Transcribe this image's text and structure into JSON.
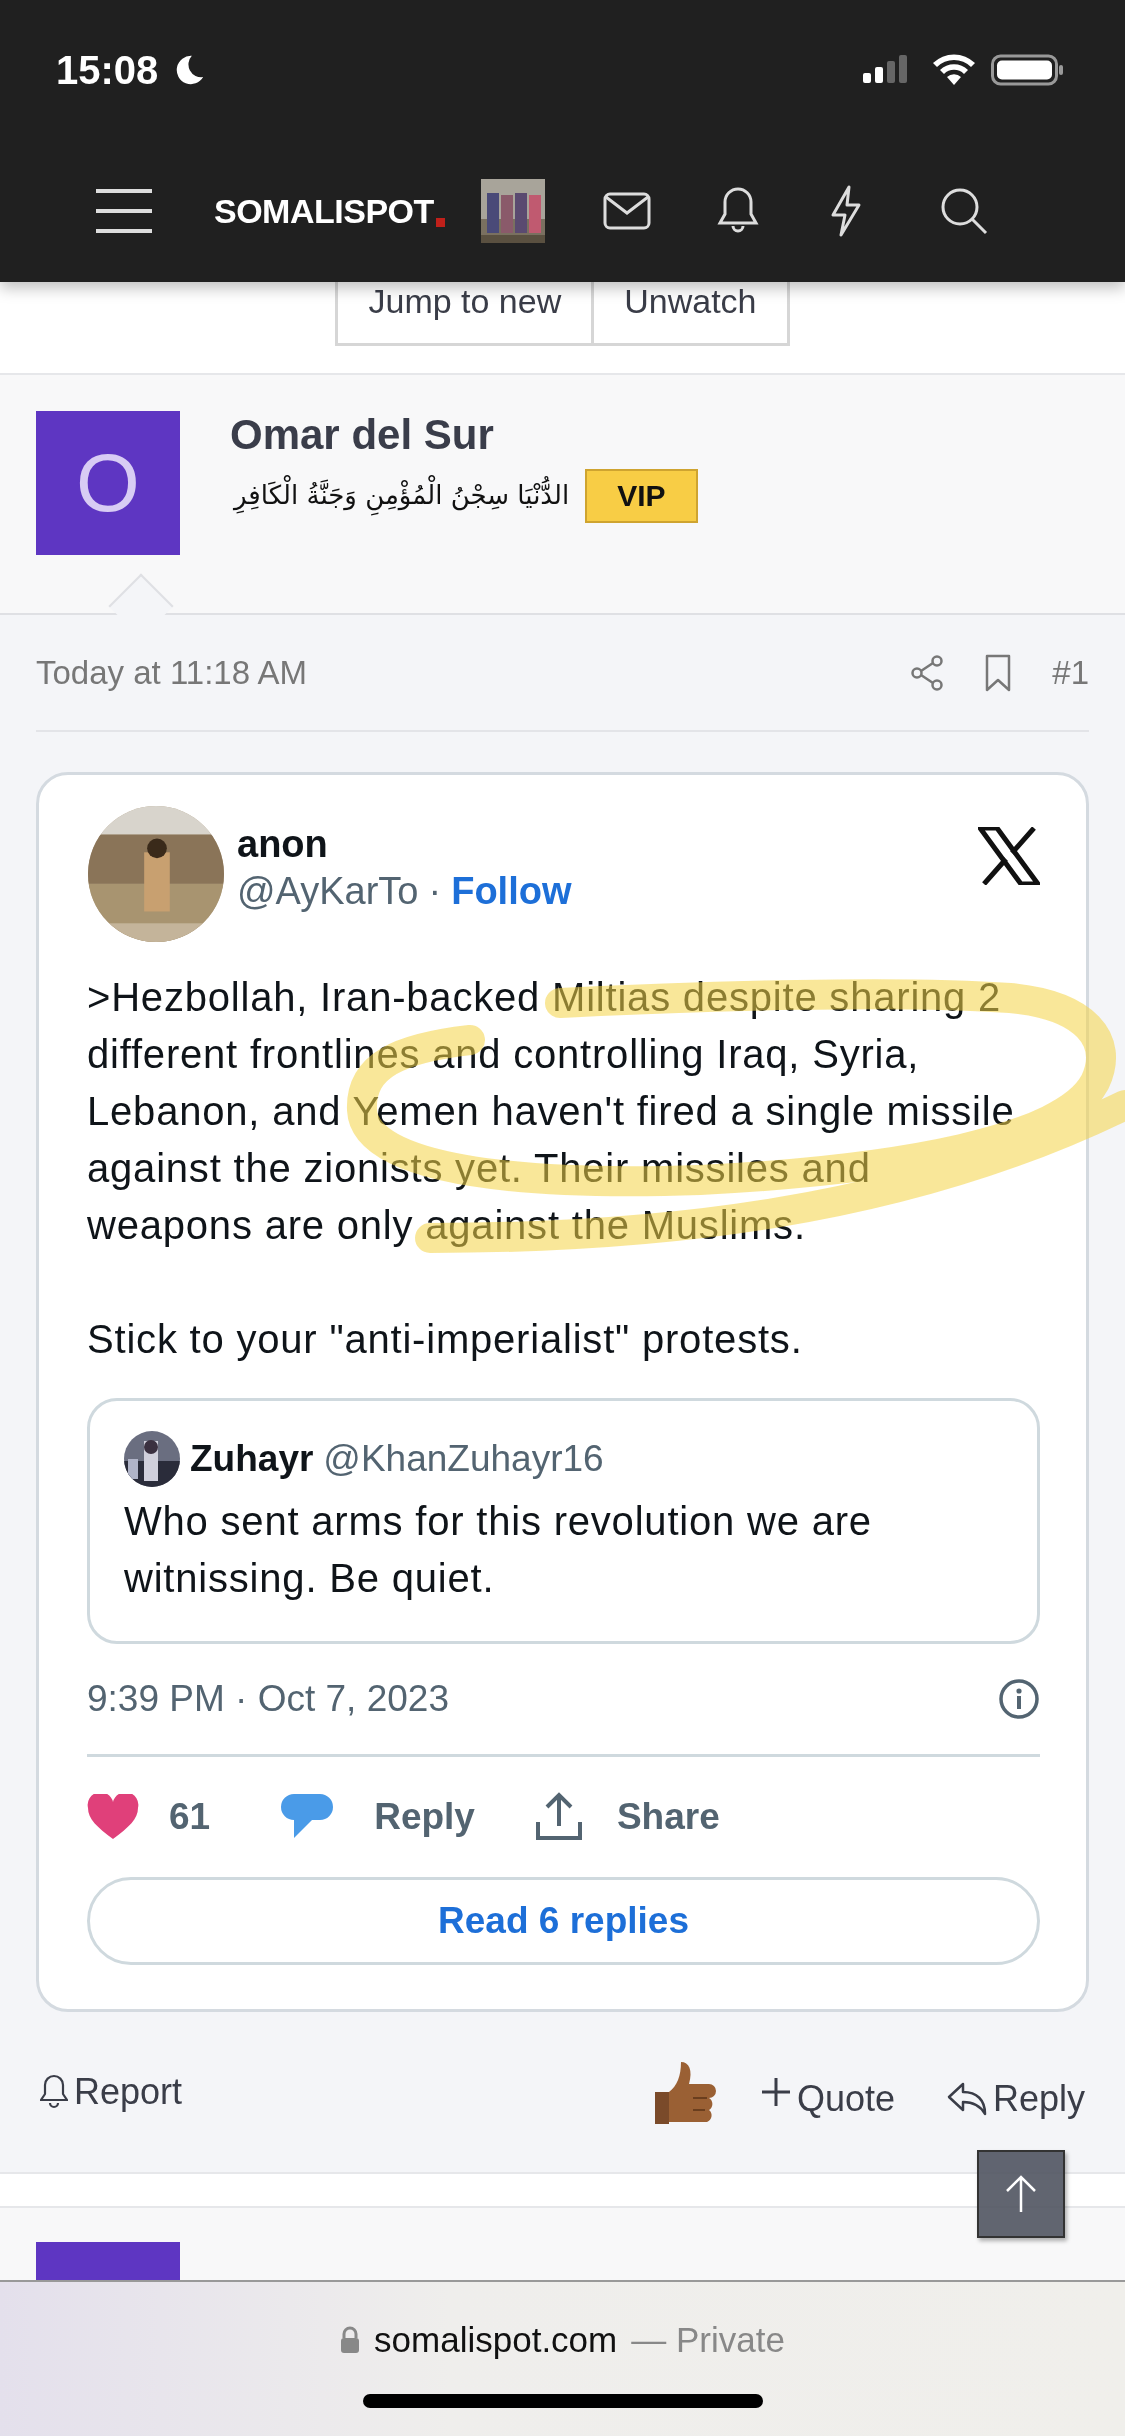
{
  "status_bar": {
    "time": "15:08"
  },
  "nav": {
    "logo": "SOMALISPOT"
  },
  "thread_buttons": [
    "Jump to new",
    "Unwatch"
  ],
  "post": {
    "author": "Omar del Sur",
    "avatar_letter": "O",
    "signature": "الدُّنْيَا سِجْنُ الْمُؤْمِنِ وَجَنَّةُ الْكَافِرِ",
    "badge": "VIP",
    "timestamp": "Today at 11:18 AM",
    "number": "#1",
    "embed": {
      "name": "anon",
      "handle": "@AyKarTo",
      "separator": "·",
      "follow": "Follow",
      "paragraphs": [
        ">Hezbollah, Iran-backed Miltias despite sharing 2 different frontlines and controlling Iraq, Syria, Lebanon, and Yemen haven't fired a single missile against the zionists yet. Their missiles and weapons are only against the Muslims.",
        "Stick to your \"anti-imperialist\" protests."
      ],
      "quote": {
        "name": "Zuhayr",
        "handle": "@KhanZuhayr16",
        "text": "Who sent arms for this revolution we are witnissing. Be quiet."
      },
      "date": "9:39 PM · Oct 7, 2023",
      "likes": "61",
      "reply": "Reply",
      "share": "Share",
      "read_replies": "Read 6 replies"
    },
    "actions": {
      "report": "Report",
      "quote": "Quote",
      "reply": "Reply"
    }
  },
  "browser": {
    "url": "somalispot.com",
    "mode": "— Private"
  }
}
